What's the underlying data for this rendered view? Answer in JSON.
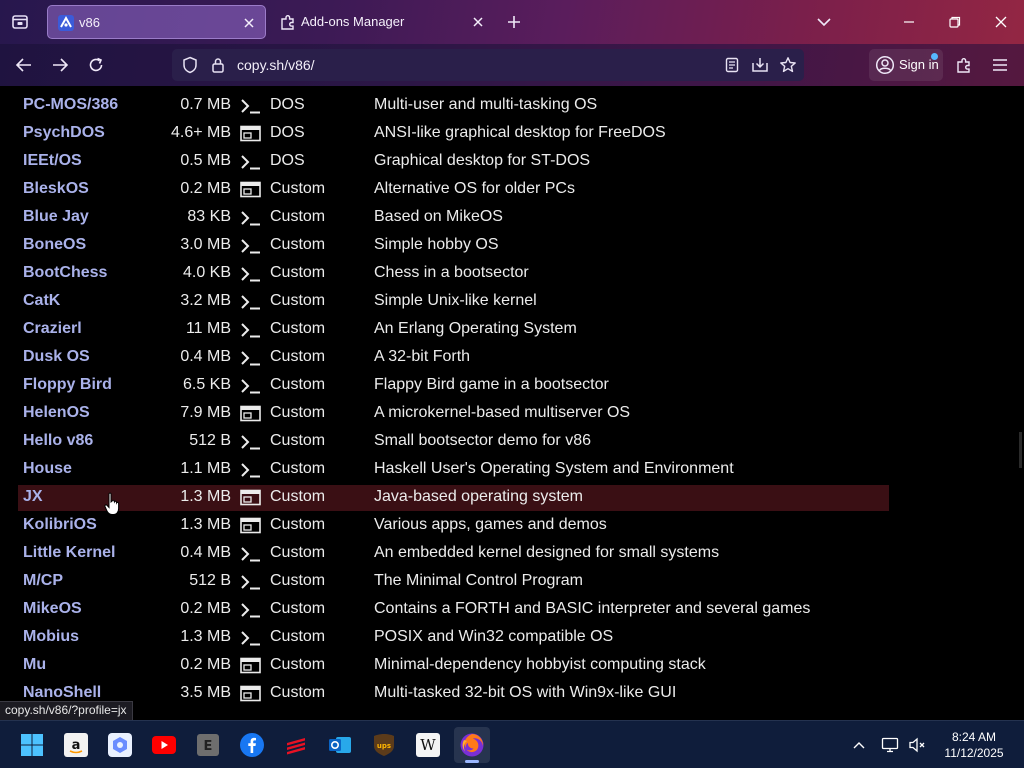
{
  "browser": {
    "tabs": [
      {
        "title": "v86",
        "active": true
      },
      {
        "title": "Add-ons Manager",
        "active": false
      }
    ],
    "url": "copy.sh/v86/",
    "sign_in_label": "Sign in",
    "status_link": "copy.sh/v86/?profile=jx"
  },
  "profiles": {
    "top_fragment": {
      "name": "",
      "size": "",
      "os": "",
      "description": "…/ …, /"
    },
    "rows": [
      {
        "name": "PC-MOS/386",
        "size": "0.7 MB",
        "interface": "terminal",
        "os": "DOS",
        "description": "Multi-user and multi-tasking OS"
      },
      {
        "name": "PsychDOS",
        "size": "4.6+ MB",
        "interface": "graphical",
        "os": "DOS",
        "description": "ANSI-like graphical desktop for FreeDOS"
      },
      {
        "name": "IEEt/OS",
        "size": "0.5 MB",
        "interface": "terminal",
        "os": "DOS",
        "description": "Graphical desktop for ST-DOS"
      },
      {
        "name": "BleskOS",
        "size": "0.2 MB",
        "interface": "graphical",
        "os": "Custom",
        "description": "Alternative OS for older PCs"
      },
      {
        "name": "Blue Jay",
        "size": "83 KB",
        "interface": "terminal",
        "os": "Custom",
        "description": "Based on MikeOS"
      },
      {
        "name": "BoneOS",
        "size": "3.0 MB",
        "interface": "terminal",
        "os": "Custom",
        "description": "Simple hobby OS"
      },
      {
        "name": "BootChess",
        "size": "4.0 KB",
        "interface": "terminal",
        "os": "Custom",
        "description": "Chess in a bootsector"
      },
      {
        "name": "CatK",
        "size": "3.2 MB",
        "interface": "terminal",
        "os": "Custom",
        "description": "Simple Unix-like kernel"
      },
      {
        "name": "Crazierl",
        "size": "11 MB",
        "interface": "terminal",
        "os": "Custom",
        "description": "An Erlang Operating System"
      },
      {
        "name": "Dusk OS",
        "size": "0.4 MB",
        "interface": "terminal",
        "os": "Custom",
        "description": "A 32-bit Forth"
      },
      {
        "name": "Floppy Bird",
        "size": "6.5 KB",
        "interface": "terminal",
        "os": "Custom",
        "description": "Flappy Bird game in a bootsector"
      },
      {
        "name": "HelenOS",
        "size": "7.9 MB",
        "interface": "graphical",
        "os": "Custom",
        "description": "A microkernel-based multiserver OS"
      },
      {
        "name": "Hello v86",
        "size": "512 B",
        "interface": "terminal",
        "os": "Custom",
        "description": "Small bootsector demo for v86"
      },
      {
        "name": "House",
        "size": "1.1 MB",
        "interface": "terminal",
        "os": "Custom",
        "description": "Haskell User's Operating System and Environment"
      },
      {
        "name": "JX",
        "size": "1.3 MB",
        "interface": "graphical",
        "os": "Custom",
        "description": "Java-based operating system",
        "hover": true
      },
      {
        "name": "KolibriOS",
        "size": "1.3 MB",
        "interface": "graphical",
        "os": "Custom",
        "description": "Various apps, games and demos"
      },
      {
        "name": "Little Kernel",
        "size": "0.4 MB",
        "interface": "terminal",
        "os": "Custom",
        "description": "An embedded kernel designed for small systems"
      },
      {
        "name": "M/CP",
        "size": "512 B",
        "interface": "terminal",
        "os": "Custom",
        "description": "The Minimal Control Program"
      },
      {
        "name": "MikeOS",
        "size": "0.2 MB",
        "interface": "terminal",
        "os": "Custom",
        "description": "Contains a FORTH and BASIC interpreter and several games"
      },
      {
        "name": "Mobius",
        "size": "1.3 MB",
        "interface": "terminal",
        "os": "Custom",
        "description": "POSIX and Win32 compatible OS"
      },
      {
        "name": "Mu",
        "size": "0.2 MB",
        "interface": "graphical",
        "os": "Custom",
        "description": "Minimal-dependency hobbyist computing stack"
      },
      {
        "name": "NanoShell",
        "size": "3.5 MB",
        "interface": "graphical",
        "os": "Custom",
        "description": "Multi-tasked 32-bit OS with Win9x-like GUI"
      },
      {
        "name": "",
        "size": "",
        "interface": "",
        "os": "",
        "description": ""
      }
    ]
  },
  "interface_glyphs": {
    "terminal": ">_",
    "graphical": "window"
  },
  "taskbar": {
    "apps": [
      "start-icon",
      "amazon-icon",
      "copilot-icon",
      "youtube-icon",
      "epub-reader-icon",
      "facebook-icon",
      "app-red-stripes-icon",
      "outlook-icon",
      "ups-icon",
      "wikipedia-icon",
      "firefox-icon"
    ],
    "time": "8:24 AM",
    "date": "11/12/2025"
  },
  "colors": {
    "link": "#aab2ea",
    "text": "#ececec",
    "hover_row": "#3a0f14",
    "background": "#000000"
  }
}
